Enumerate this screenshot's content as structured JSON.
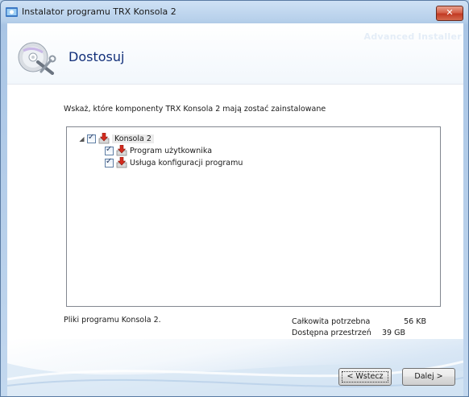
{
  "window": {
    "title": "Instalator programu TRX Konsola 2",
    "close_label": "✕",
    "brand_watermark": "Advanced Installer"
  },
  "header": {
    "title": "Dostosuj"
  },
  "main": {
    "instruction": "Wskaż, które komponenty TRX Konsola 2 mają zostać zainstalowane",
    "tree": {
      "root": {
        "label": "Konsola 2",
        "expander": "◢",
        "checked": true
      },
      "children": [
        {
          "label": "Program użytkownika",
          "checked": true
        },
        {
          "label": "Usługa konfiguracji programu",
          "checked": true
        }
      ]
    },
    "description": "Pliki programu Konsola 2.",
    "disk_space": {
      "required_label": "Całkowita potrzebna",
      "required_value": "56 KB",
      "available_label": "Dostępna przestrzeń",
      "available_value": "39 GB"
    }
  },
  "buttons": {
    "back": "< Wstecz",
    "next": "Dalej >"
  },
  "colors": {
    "title_accent": "#13307a",
    "close_button": "#c23a23",
    "window_frame": "#b9d1ea"
  }
}
